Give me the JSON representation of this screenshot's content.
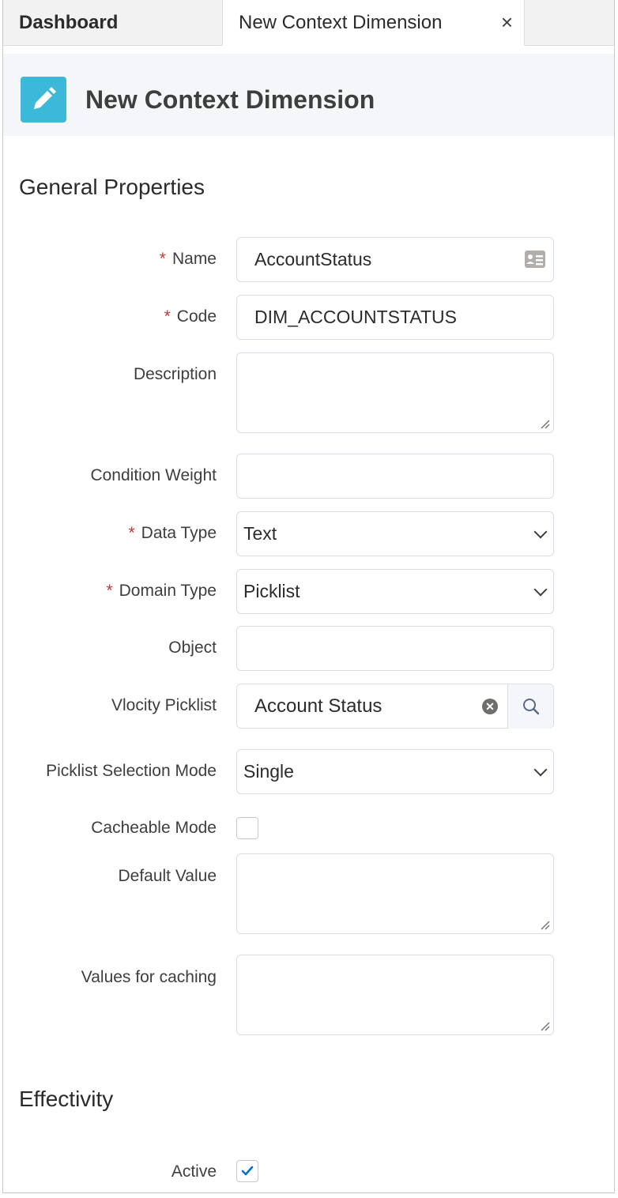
{
  "tabs": {
    "dashboard": "Dashboard",
    "active": "New Context Dimension",
    "close": "×"
  },
  "header": {
    "title": "New Context Dimension",
    "icon": "edit-pencil-icon",
    "icon_color": "#3cb8d8"
  },
  "sections": {
    "general": "General Properties",
    "effectivity": "Effectivity"
  },
  "form": {
    "name": {
      "required": "*",
      "label": "Name",
      "value": "AccountStatus",
      "icon": "contact-card-icon"
    },
    "code": {
      "required": "*",
      "label": "Code",
      "value": "DIM_ACCOUNTSTATUS"
    },
    "description": {
      "label": "Description",
      "value": ""
    },
    "condition_weight": {
      "label": "Condition Weight",
      "value": ""
    },
    "data_type": {
      "required": "*",
      "label": "Data Type",
      "value": "Text"
    },
    "domain_type": {
      "required": "*",
      "label": "Domain Type",
      "value": "Picklist"
    },
    "object": {
      "label": "Object",
      "value": ""
    },
    "vlocity_picklist": {
      "label": "Vlocity Picklist",
      "value": "Account Status",
      "clear_icon": "clear-icon",
      "search_icon": "search-icon"
    },
    "picklist_selection_mode": {
      "label": "Picklist Selection Mode",
      "value": "Single"
    },
    "cacheable_mode": {
      "label": "Cacheable Mode",
      "checked": false
    },
    "default_value": {
      "label": "Default Value",
      "value": ""
    },
    "values_for_caching": {
      "label": "Values for caching",
      "value": ""
    },
    "active": {
      "label": "Active",
      "checked": true
    }
  },
  "colors": {
    "required": "#c23934",
    "check": "#0070d2"
  }
}
